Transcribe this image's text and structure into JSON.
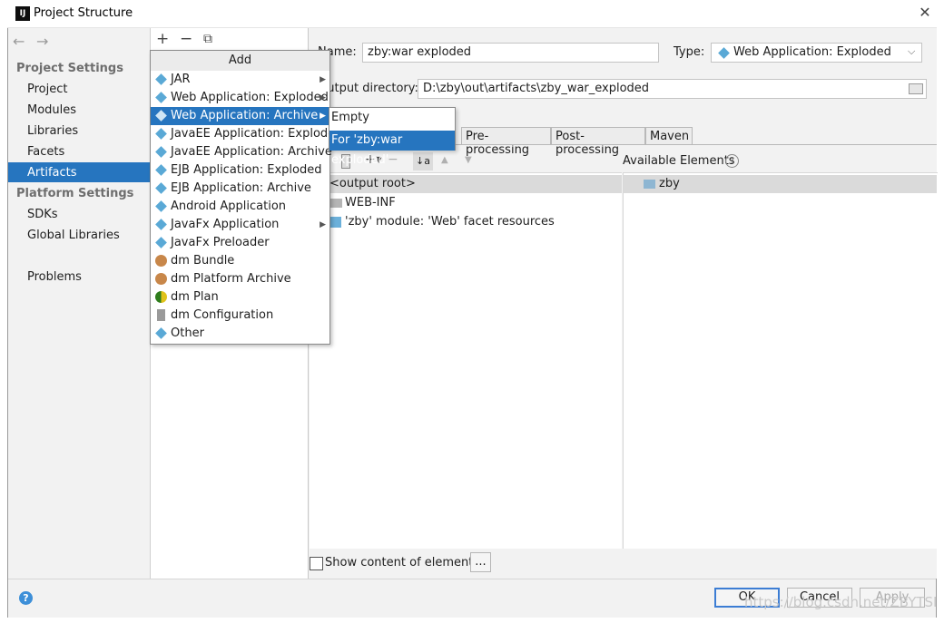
{
  "window": {
    "title": "Project Structure",
    "close": "✕"
  },
  "nav": {
    "back": "←",
    "forward": "→",
    "project_settings": "Project Settings",
    "items_project": [
      "Project",
      "Modules",
      "Libraries",
      "Facets",
      "Artifacts"
    ],
    "platform_settings": "Platform Settings",
    "items_platform": [
      "SDKs",
      "Global Libraries"
    ],
    "problems": "Problems",
    "selected": "Artifacts"
  },
  "toolbar": {
    "add": "+",
    "remove": "−",
    "copy": "⧉"
  },
  "popup": {
    "header": "Add",
    "items": [
      {
        "label": "JAR",
        "icon": "artifact-diamond-icon",
        "submenu": true
      },
      {
        "label": "Web Application: Exploded",
        "icon": "web-artifact-icon",
        "submenu": true
      },
      {
        "label": "Web Application: Archive",
        "icon": "web-artifact-icon",
        "submenu": true,
        "selected": true
      },
      {
        "label": "JavaEE Application: Exploded",
        "icon": "javaee-artifact-icon",
        "submenu": false
      },
      {
        "label": "JavaEE Application: Archive",
        "icon": "javaee-artifact-icon",
        "submenu": false
      },
      {
        "label": "EJB Application: Exploded",
        "icon": "ejb-artifact-icon",
        "submenu": false
      },
      {
        "label": "EJB Application: Archive",
        "icon": "ejb-artifact-icon",
        "submenu": false
      },
      {
        "label": "Android Application",
        "icon": "artifact-diamond-icon",
        "submenu": false
      },
      {
        "label": "JavaFx Application",
        "icon": "artifact-diamond-icon",
        "submenu": true
      },
      {
        "label": "JavaFx Preloader",
        "icon": "artifact-diamond-icon",
        "submenu": false
      },
      {
        "label": "dm Bundle",
        "icon": "dm-bundle-icon",
        "submenu": false
      },
      {
        "label": "dm Platform Archive",
        "icon": "dm-platform-icon",
        "submenu": false
      },
      {
        "label": "dm Plan",
        "icon": "dm-plan-icon",
        "submenu": false
      },
      {
        "label": "dm Configuration",
        "icon": "dm-config-icon",
        "submenu": false
      },
      {
        "label": "Other",
        "icon": "artifact-diamond-icon",
        "submenu": false
      }
    ],
    "submenu_arrow": "▶"
  },
  "submenu": {
    "items": [
      "Empty",
      "For 'zby:war exploded'"
    ],
    "selected_index": 1
  },
  "form": {
    "name_label": "Name:",
    "name_value": "zby:war exploded",
    "type_label": "Type:",
    "type_value": "Web Application: Exploded",
    "output_label": "Output directory:",
    "output_value": "D:\\zby\\out\\artifacts\\zby_war_exploded"
  },
  "tabs": [
    "Pre-processing",
    "Post-processing",
    "Maven"
  ],
  "layout_toolbar": {
    "add": "+▾",
    "remove": "−",
    "sort": "↓a",
    "up": "▲",
    "down": "▼"
  },
  "available_elements": {
    "label": "Available Elements",
    "help": "?",
    "items": [
      "zby"
    ]
  },
  "tree": {
    "items": [
      "<output root>",
      "WEB-INF",
      "'zby' module: 'Web' facet resources"
    ]
  },
  "show_content": {
    "label": "Show content of elements",
    "checked": false,
    "more": "..."
  },
  "buttons": {
    "ok": "OK",
    "cancel": "Cancel",
    "apply": "Apply",
    "help": "?"
  },
  "watermark": "https://blog.csdn.net/ZBYTSI",
  "colors": {
    "selection": "#2675bf",
    "dialog_bg": "#f2f2f2",
    "accent_border": "#3c7dd4"
  }
}
